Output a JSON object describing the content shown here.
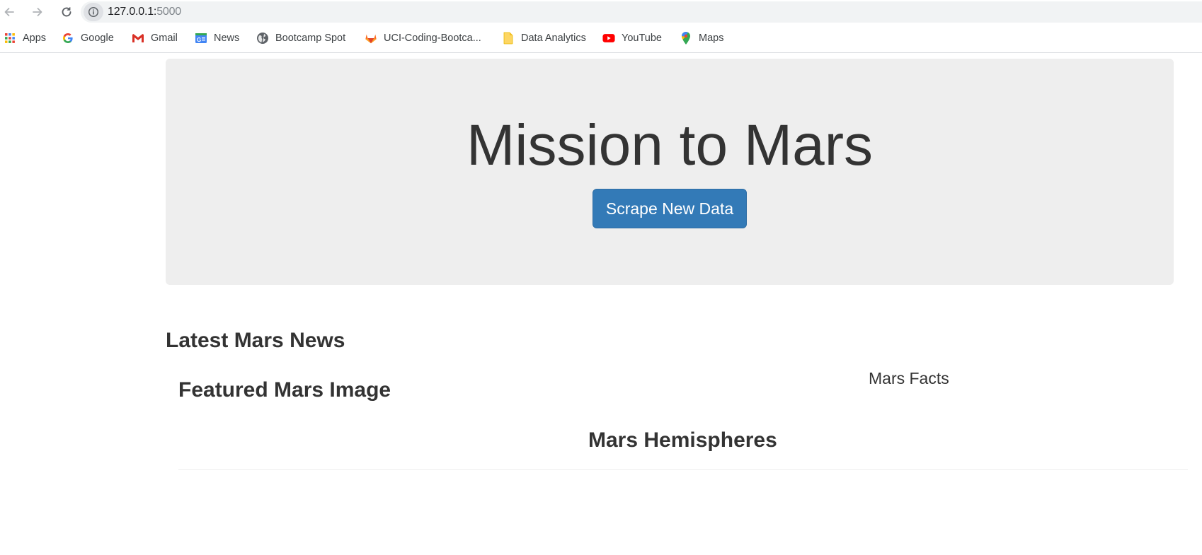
{
  "browser": {
    "url_host": "127.0.0.1:",
    "url_port": "5000",
    "icons": {
      "back": "arrow-left-icon",
      "forward": "arrow-right-icon",
      "reload": "reload-icon",
      "site_info": "info-icon"
    },
    "bookmarks": [
      {
        "label": "Apps",
        "icon": "apps-grid-icon"
      },
      {
        "label": "Google",
        "icon": "google-icon"
      },
      {
        "label": "Gmail",
        "icon": "gmail-icon"
      },
      {
        "label": "News",
        "icon": "google-news-icon"
      },
      {
        "label": "Bootcamp Spot",
        "icon": "globe-icon"
      },
      {
        "label": "UCI-Coding-Bootca...",
        "icon": "gitlab-icon"
      },
      {
        "label": "Data Analytics",
        "icon": "folder-icon"
      },
      {
        "label": "YouTube",
        "icon": "youtube-icon"
      },
      {
        "label": "Maps",
        "icon": "maps-pin-icon"
      }
    ]
  },
  "page": {
    "jumbotron": {
      "title": "Mission to Mars",
      "button_label": "Scrape New Data",
      "button_color": "#337ab7",
      "background": "#eeeeee"
    },
    "sections": {
      "news_heading": "Latest Mars News",
      "image_heading": "Featured Mars Image",
      "facts_heading": "Mars Facts",
      "hemispheres_heading": "Mars Hemispheres"
    }
  }
}
